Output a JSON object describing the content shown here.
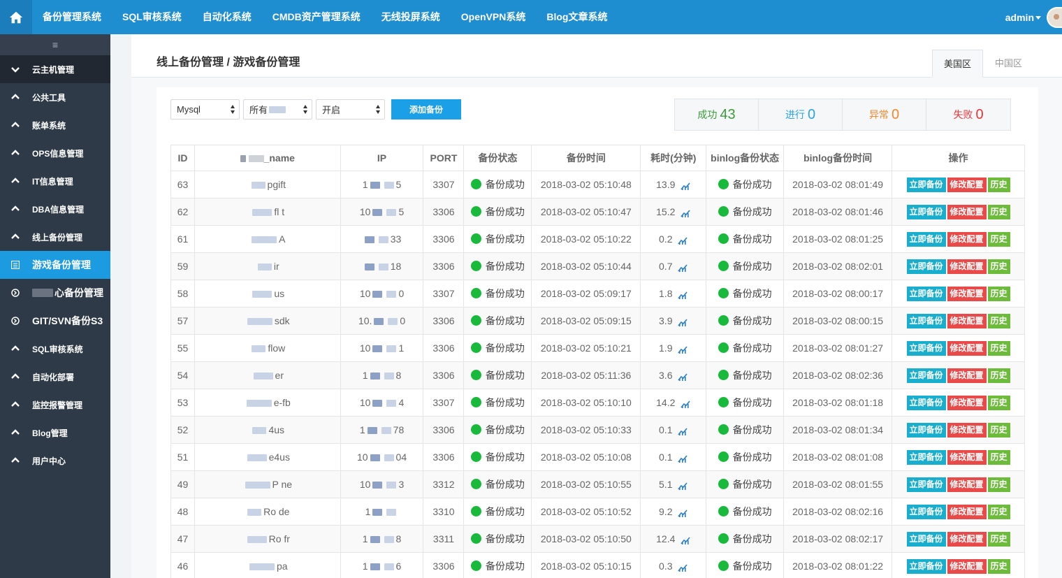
{
  "topnav": {
    "items": [
      "备份管理系统",
      "SQL审核系统",
      "自动化系统",
      "CMDB资产管理系统",
      "无线投屏系统",
      "OpenVPN系统",
      "Blog文章系统"
    ],
    "user": "admin"
  },
  "sidebar": {
    "toggle": "≡",
    "items": [
      {
        "label": "云主机管理",
        "state": "expanded"
      },
      {
        "label": "公共工具",
        "state": "collapsed"
      },
      {
        "label": "账单系统",
        "state": "collapsed"
      },
      {
        "label": "OPS信息管理",
        "state": "collapsed"
      },
      {
        "label": "IT信息管理",
        "state": "collapsed"
      },
      {
        "label": "DBA信息管理",
        "state": "collapsed"
      },
      {
        "label": "线上备份管理",
        "state": "collapsed"
      },
      {
        "label": "游戏备份管理",
        "state": "active"
      },
      {
        "label": "心备份管理",
        "state": "sub"
      },
      {
        "label": "GIT/SVN备份S3",
        "state": "sub"
      },
      {
        "label": "SQL审核系统",
        "state": "collapsed"
      },
      {
        "label": "自动化部署",
        "state": "collapsed"
      },
      {
        "label": "监控报警管理",
        "state": "collapsed"
      },
      {
        "label": "Blog管理",
        "state": "collapsed"
      },
      {
        "label": "用户中心",
        "state": "collapsed"
      }
    ]
  },
  "page": {
    "title": "线上备份管理 / 游戏备份管理",
    "tabs": [
      "美国区",
      "中国区"
    ],
    "active_tab": "美国区"
  },
  "filters": {
    "db_type": "Mysql",
    "all_label": "所有",
    "status": "开启",
    "add_button": "添加备份"
  },
  "stats": {
    "success_label": "成功",
    "success_count": "43",
    "running_label": "进行",
    "running_count": "0",
    "abnormal_label": "异常",
    "abnormal_count": "0",
    "failed_label": "失败",
    "failed_count": "0"
  },
  "table": {
    "headers": [
      "ID",
      "_name",
      "IP",
      "PORT",
      "备份状态",
      "备份时间",
      "耗时(分钟)",
      "binlog备份状态",
      "binlog备份时间",
      "操作"
    ],
    "actions": {
      "backup_now": "立即备份",
      "edit_config": "修改配置",
      "history": "历史"
    },
    "rows": [
      {
        "id": "63",
        "name": "pgift",
        "ip_a": "1",
        "ip_b": "5",
        "port": "3307",
        "status": "备份成功",
        "time": "2018-03-02 05:10:48",
        "duration": "13.9",
        "binlog_status": "备份成功",
        "binlog_time": "2018-03-02 08:01:49"
      },
      {
        "id": "62",
        "name": "fl t",
        "ip_a": "10",
        "ip_b": "5",
        "port": "3306",
        "status": "备份成功",
        "time": "2018-03-02 05:10:47",
        "duration": "15.2",
        "binlog_status": "备份成功",
        "binlog_time": "2018-03-02 08:01:46"
      },
      {
        "id": "61",
        "name": "A",
        "ip_a": "",
        "ip_b": "33",
        "port": "3306",
        "status": "备份成功",
        "time": "2018-03-02 05:10:22",
        "duration": "0.2",
        "binlog_status": "备份成功",
        "binlog_time": "2018-03-02 08:01:25"
      },
      {
        "id": "59",
        "name": "ir",
        "ip_a": "",
        "ip_b": "18",
        "port": "3306",
        "status": "备份成功",
        "time": "2018-03-02 05:10:44",
        "duration": "0.7",
        "binlog_status": "备份成功",
        "binlog_time": "2018-03-02 08:02:01"
      },
      {
        "id": "58",
        "name": "us",
        "ip_a": "10",
        "ip_b": "0",
        "port": "3307",
        "status": "备份成功",
        "time": "2018-03-02 05:09:17",
        "duration": "1.8",
        "binlog_status": "备份成功",
        "binlog_time": "2018-03-02 08:00:17"
      },
      {
        "id": "57",
        "name": "sdk",
        "ip_a": "10.",
        "ip_b": "0",
        "port": "3306",
        "status": "备份成功",
        "time": "2018-03-02 05:09:15",
        "duration": "3.9",
        "binlog_status": "备份成功",
        "binlog_time": "2018-03-02 08:00:15"
      },
      {
        "id": "55",
        "name": "flow",
        "ip_a": "10",
        "ip_b": "1",
        "port": "3306",
        "status": "备份成功",
        "time": "2018-03-02 05:10:21",
        "duration": "1.9",
        "binlog_status": "备份成功",
        "binlog_time": "2018-03-02 08:01:27"
      },
      {
        "id": "54",
        "name": "er",
        "ip_a": "1",
        "ip_b": "8",
        "port": "3306",
        "status": "备份成功",
        "time": "2018-03-02 05:11:36",
        "duration": "3.6",
        "binlog_status": "备份成功",
        "binlog_time": "2018-03-02 08:02:36"
      },
      {
        "id": "53",
        "name": "e-fb",
        "ip_a": "10",
        "ip_b": "4",
        "port": "3307",
        "status": "备份成功",
        "time": "2018-03-02 05:10:10",
        "duration": "14.2",
        "binlog_status": "备份成功",
        "binlog_time": "2018-03-02 08:01:18"
      },
      {
        "id": "52",
        "name": "4us",
        "ip_a": "1",
        "ip_b": "78",
        "port": "3306",
        "status": "备份成功",
        "time": "2018-03-02 05:10:33",
        "duration": "0.1",
        "binlog_status": "备份成功",
        "binlog_time": "2018-03-02 08:01:34"
      },
      {
        "id": "51",
        "name": "e4us",
        "ip_a": "10",
        "ip_b": "04",
        "port": "3306",
        "status": "备份成功",
        "time": "2018-03-02 05:10:08",
        "duration": "0.1",
        "binlog_status": "备份成功",
        "binlog_time": "2018-03-02 08:01:08"
      },
      {
        "id": "49",
        "name": "P ne",
        "ip_a": "10",
        "ip_b": "3",
        "port": "3312",
        "status": "备份成功",
        "time": "2018-03-02 05:10:55",
        "duration": "5.1",
        "binlog_status": "备份成功",
        "binlog_time": "2018-03-02 08:01:55"
      },
      {
        "id": "48",
        "name": "Ro de",
        "ip_a": "1",
        "ip_b": "",
        "port": "3310",
        "status": "备份成功",
        "time": "2018-03-02 05:10:52",
        "duration": "9.2",
        "binlog_status": "备份成功",
        "binlog_time": "2018-03-02 08:02:16"
      },
      {
        "id": "47",
        "name": "Ro fr",
        "ip_a": "1",
        "ip_b": "8",
        "port": "3311",
        "status": "备份成功",
        "time": "2018-03-02 05:10:50",
        "duration": "12.4",
        "binlog_status": "备份成功",
        "binlog_time": "2018-03-02 08:02:17"
      },
      {
        "id": "46",
        "name": "pa",
        "ip_a": "1",
        "ip_b": "6",
        "port": "3306",
        "status": "备份成功",
        "time": "2018-03-02 05:10:15",
        "duration": "0.3",
        "binlog_status": "备份成功",
        "binlog_time": "2018-03-02 08:01:22"
      }
    ]
  }
}
